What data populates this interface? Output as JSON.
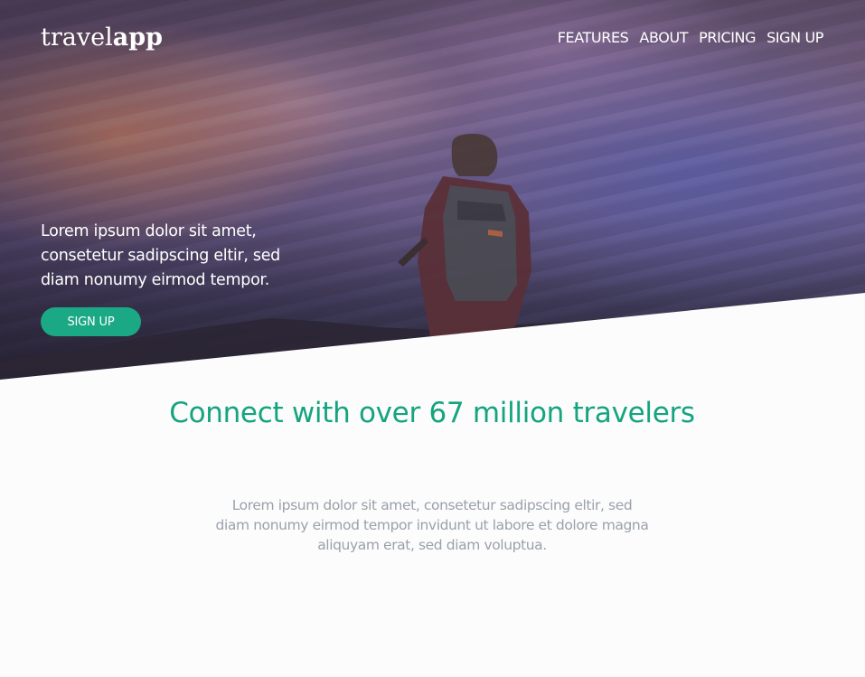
{
  "brand": {
    "name_light": "travel",
    "name_bold": "app"
  },
  "nav": {
    "items": [
      {
        "label": "FEATURES"
      },
      {
        "label": "ABOUT"
      },
      {
        "label": "PRICING"
      },
      {
        "label": "SIGN UP"
      }
    ]
  },
  "hero": {
    "text": "Lorem ipsum dolor sit amet, consetetur sadipscing eltir, sed diam nonumy eirmod tempor.",
    "button_label": "SIGN UP"
  },
  "content": {
    "headline": "Connect with over 67 million travelers",
    "subtext": "Lorem ipsum dolor sit amet, consetetur sadipscing eltir, sed diam nonumy eirmod tempor invidunt ut labore et dolore magna aliquyam erat, sed diam voluptua."
  },
  "colors": {
    "accent": "#14a47e",
    "button": "#1aa885",
    "body_text": "#9aa1aa",
    "background": "#fcfcfd"
  }
}
